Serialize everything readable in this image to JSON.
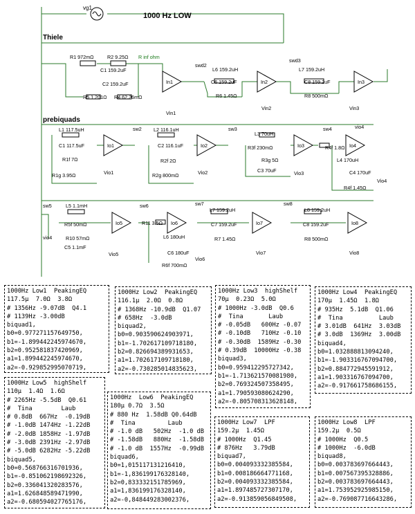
{
  "schematic": {
    "title": "1000 Hz   LOW",
    "source_label": "vg1",
    "section_thiele": "Thiele",
    "section_prebiquads": "prebiquads",
    "thiele": {
      "r1": "R1 972mΩ",
      "r2": "R2 9.25Ω",
      "r_inf": "R inf ohm",
      "c1": "C1 159.2uF",
      "c2": "C2 159.2uF",
      "r5": "R5 1.201Ω",
      "r4": "R4 62.26mΩ",
      "in1": "In1",
      "vin1": "Vin1",
      "swd2": "swd2",
      "l6": "L6 159.2uH",
      "c6": "C6 159.2uF",
      "r6": "R6 1.45Ω",
      "in2": "In2",
      "vin2": "Vin2",
      "swd3": "swd3",
      "l7": "L7 159.2uH",
      "c8": "C8 159.2uF",
      "r8": "R8 500mΩ",
      "in3": "In3",
      "vin3": "Vin3"
    },
    "pre": {
      "l1": "L1 117.5uH",
      "c1": "C1 117.5uF",
      "r1f": "R1f 7Ω",
      "r1g": "R1g 3.95Ω",
      "io1": "Io1",
      "vio1": "Vio1",
      "sw2": "sw2",
      "l2": "L2 116.1uH",
      "c2": "C2 116.1uF",
      "r2f": "R2f 2Ω",
      "r2g": "R2g 800mΩ",
      "io2": "Io2",
      "vio2": "Vio2",
      "sw3": "sw3",
      "l3": "L3 70uH",
      "r3f": "R3f 230mΩ",
      "r3g": "R3g 5Ω",
      "c3": "C3 70uF",
      "io3": "Io3",
      "vio3": "Vio3",
      "sw4": "sw4",
      "r4f": "R4f 1.8Ω",
      "l4": "L4 170uH",
      "c4": "C4 170uF",
      "r4f2": "R4f 1.45Ω",
      "io4": "Io4",
      "vio4": "Vio4",
      "vio4_top": "vio4"
    },
    "bottom": {
      "sw5": "sw5",
      "l5": "L5 1.1mH",
      "r5f": "R5f 50mΩ",
      "r10": "R10 57mΩ",
      "c5": "C5 1.1mF",
      "io5": "Io5",
      "vio5": "Vio5",
      "vio4": "vio4",
      "sw6": "sw6",
      "r11": "R11 3.5Ω",
      "l6": "L6 180uH",
      "c6": "C6 180uF",
      "r6f": "R6f 700mΩ",
      "io6": "Io6",
      "vio6": "Vio6",
      "sw7": "sw7",
      "l7": "L7 159.2uH",
      "c7": "C7 159.2uF",
      "r7": "R7 1.45Ω",
      "io7": "Io7",
      "vio7": "Vio7",
      "sw8": "sw8",
      "l8": "L8 159.2uH",
      "c8": "C8 159.2uF",
      "r8": "R8 500mΩ",
      "io8": "Io8",
      "vio8": "Vio8"
    }
  },
  "boxes": [
    {
      "name": "low1",
      "lines": [
        "1000Hz Low1  PeakingEQ",
        "117.5µ  7.0Ω  3.8Ω",
        "# 1356Hz -9.07dB  Q4.1",
        "# 1139Hz -3.00dB",
        "biquad1,",
        "b0=0.977271157649750,",
        "b1=-1.899442245974670,",
        "b2=0.952581837420969,",
        "a1=1.899442245974670,",
        "a2=-0.929852995070719,"
      ]
    },
    {
      "name": "low2",
      "lines": [
        "1000Hz Low2  PeakingEQ",
        "116.1µ  2.0Ω  0.8Ω",
        "# 1368Hz -10.9dB  Q1.07",
        "# 658Hz  -3.0dB",
        "biquad2,",
        "b0=0.903590624903971,",
        "b1=-1.702617109718180,",
        "b2=0.826694389931653,",
        "a1=1.702617109718180,",
        "a2=-0.730285014835623,"
      ]
    },
    {
      "name": "low3",
      "lines": [
        "1000Hz Low3  highShelf",
        "70µ  0.23Ω  5.0Ω",
        "# 1000Hz -3.0dB  Q0.6",
        "#  Tina       Laub",
        "# -0.05dB   600Hz -0.07",
        "# -0.10dB   710Hz -0.10",
        "# -0.30dB  1589Hz -0.30",
        "# 0.39dB  10000Hz -0.38",
        "biquad3,",
        "b0=0.959412295727342,",
        "b1=-1.713621570081980,",
        "b2=0.769324507358495,",
        "a1=1.790593080624290,",
        "a2=-0.805708313628148,"
      ]
    },
    {
      "name": "low4",
      "lines": [
        "1000Hz Low4  PeakingEQ",
        "170µ  1.45Ω  1.8Ω",
        "# 935Hz  5.1dB  Q1.06",
        "#  Tina          Laub",
        "# 3.01dB  641Hz  3.03dB",
        "# 3.0dB  1369Hz  3.00dB",
        "biquad4,",
        "b0=1.032888813094240,",
        "b1=-1.903316767094700,",
        "b2=0.884772945591912,",
        "a1=1.903316767094700,",
        "a2=-0.917661758686155,"
      ]
    },
    {
      "name": "low5",
      "lines": [
        "1000Hz Low5  highShelf",
        "110µ  1.4Ω  1.6Ω",
        "# 2265Hz -5.5dB  Q0.61",
        "#  Tina        Laub",
        "# 0.8dB  667Hz  -0.19dB",
        "# -1.0dB 1474Hz -1.22dB",
        "# -2.0dB 1858Hz -1.97dB",
        "# -3.0dB 2391Hz -2.97dB",
        "# -5.0dB 6282Hz -5.22dB",
        "biquad5,",
        "b0=0.568766316701936,",
        "b1=-0.851062198692326,",
        "b2=0.336041320283576,",
        "a1=1.626848589471990,",
        "a2=-0.680594027765176,"
      ]
    },
    {
      "name": "low6",
      "lines": [
        "1000Hz  Low6  PeakingEQ",
        "180µ 0.7Ω  3.5Ω",
        "# 880 Hz  1.58dB Q0.64dB",
        "#  Tina         Laub",
        "# -1.0 dB   502Hz  -1.0 dB",
        "# -1.58dB   880Hz  -1.58dB",
        "# -1.0 dB  1557Hz  -0.99dB",
        "biquad6,",
        "b0=1,015117131216410,",
        "b1=-1,836199176328140,",
        "b2=0,833332151785969,",
        "a1=1,836199176328140,",
        "a2=-0,848449283002376,"
      ]
    },
    {
      "name": "low7",
      "lines": [
        "1000Hz Low7  LPF",
        "159.2µ  1.45Ω",
        "# 1000Hz  Q1.45",
        "# 876Hz   3.79dB",
        "biquad7,",
        "b0=0.004093332385584,",
        "b1=0.008186664771168,",
        "b2=0.004093332385584,",
        "a1=1.897485727307170,",
        "a2=-0.913859056849508,"
      ]
    },
    {
      "name": "low8",
      "lines": [
        "1000Hz Low8  LPF",
        "159.2µ  0.5Ω",
        "# 1000Hz  Q0.5",
        "# 1000Hz  -6.0dB",
        "biquad8,",
        "b0=0.003783697664443,",
        "b1=0.007567395328886,",
        "b2=0.003783697664443,",
        "a1=1.753952925985150,",
        "a2=-0.769087716643286,"
      ]
    }
  ]
}
